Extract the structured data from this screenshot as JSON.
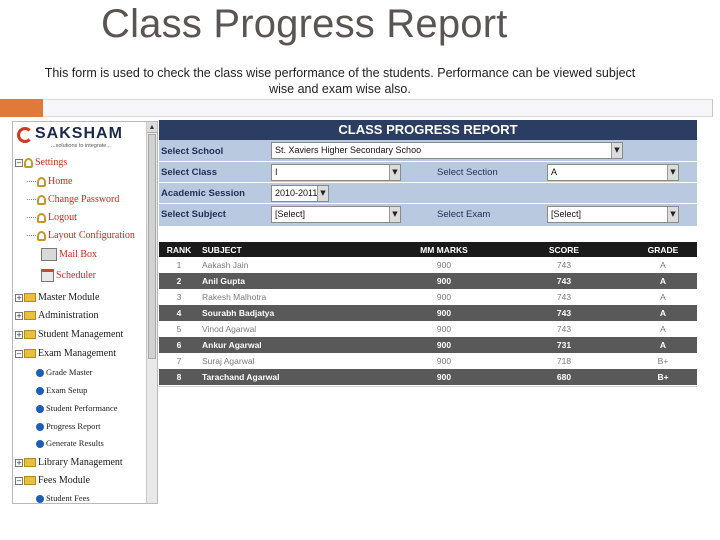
{
  "slide": {
    "title": "Class Progress Report",
    "description": "This form is used to check the class wise performance of the students. Performance can be viewed subject wise and exam wise also."
  },
  "logo": {
    "brand": "SAKSHAM",
    "tagline": "...solutions to integrate..."
  },
  "tree": {
    "settings": "Settings",
    "home": "Home",
    "change_password": "Change Password",
    "logout": "Logout",
    "layout_configuration": "Layout Configuration",
    "mail_box": "Mail Box",
    "scheduler": "Scheduler",
    "master_module": "Master Module",
    "administration": "Administration",
    "student_management": "Student Management",
    "exam_management": "Exam Management",
    "grade_master": "Grade Master",
    "exam_setup": "Exam Setup",
    "student_performance": "Student Performance",
    "progress_report": "Progress Report",
    "generate_results": "Generate Results",
    "library_management": "Library Management",
    "fees_module": "Fees Module",
    "student_fees": "Student Fees"
  },
  "report": {
    "title": "CLASS PROGRESS REPORT",
    "form": {
      "school_label": "Select School",
      "school_value": "St. Xaviers Higher Secondary Schoo",
      "class_label": "Select Class",
      "class_value": "I",
      "section_label": "Select Section",
      "section_value": "A",
      "session_label": "Academic Session",
      "session_value": "2010-2011",
      "subject_label": "Select Subject",
      "subject_value": "[Select]",
      "exam_label": "Select Exam",
      "exam_value": "[Select]"
    },
    "columns": {
      "rank": "RANK",
      "subject": "SUBJECT",
      "mm_marks": "MM MARKS",
      "score": "SCORE",
      "grade": "GRADE"
    },
    "rows": [
      {
        "rank": "1",
        "name": "Aakash Jain",
        "mm": "900",
        "score": "743",
        "grade": "A"
      },
      {
        "rank": "2",
        "name": "Anil Gupta",
        "mm": "900",
        "score": "743",
        "grade": "A"
      },
      {
        "rank": "3",
        "name": "Rakesh Malhotra",
        "mm": "900",
        "score": "743",
        "grade": "A"
      },
      {
        "rank": "4",
        "name": "Sourabh Badjatya",
        "mm": "900",
        "score": "743",
        "grade": "A"
      },
      {
        "rank": "5",
        "name": "Vinod Agarwal",
        "mm": "900",
        "score": "743",
        "grade": "A"
      },
      {
        "rank": "6",
        "name": "Ankur Agarwal",
        "mm": "900",
        "score": "731",
        "grade": "A"
      },
      {
        "rank": "7",
        "name": "Suraj Agarwal",
        "mm": "900",
        "score": "718",
        "grade": "B+"
      },
      {
        "rank": "8",
        "name": "Tarachand Agarwal",
        "mm": "900",
        "score": "680",
        "grade": "B+"
      }
    ]
  }
}
